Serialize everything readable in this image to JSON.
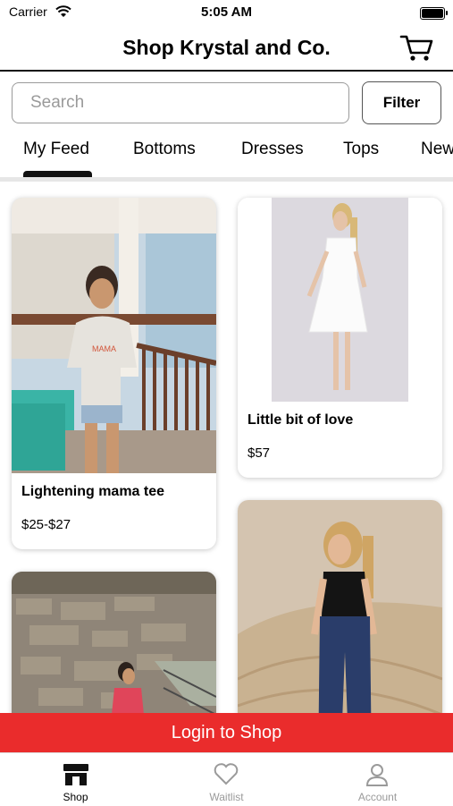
{
  "status_bar": {
    "carrier": "Carrier",
    "time": "5:05 AM"
  },
  "header": {
    "title": "Shop Krystal and Co.",
    "cart_icon": "cart-icon"
  },
  "search": {
    "placeholder": "Search",
    "value": ""
  },
  "filter": {
    "label": "Filter"
  },
  "tabs": [
    {
      "label": "My Feed",
      "selected": true
    },
    {
      "label": "Bottoms"
    },
    {
      "label": "Dresses"
    },
    {
      "label": "Tops"
    },
    {
      "label": "New"
    }
  ],
  "products": [
    {
      "name": "Lightening mama tee",
      "price": "$25-$27"
    },
    {
      "name": "Little bit of love",
      "price": "$57"
    },
    {
      "name": "",
      "price": ""
    },
    {
      "name": "",
      "price": ""
    }
  ],
  "login_bar": {
    "label": "Login to Shop"
  },
  "tab_bar": [
    {
      "label": "Shop",
      "icon": "storefront-icon",
      "active": true
    },
    {
      "label": "Waitlist",
      "icon": "heart-icon"
    },
    {
      "label": "Account",
      "icon": "person-icon"
    }
  ],
  "colors": {
    "accent_red": "#ea2c2c",
    "inactive_gray": "#9a9a9a"
  }
}
